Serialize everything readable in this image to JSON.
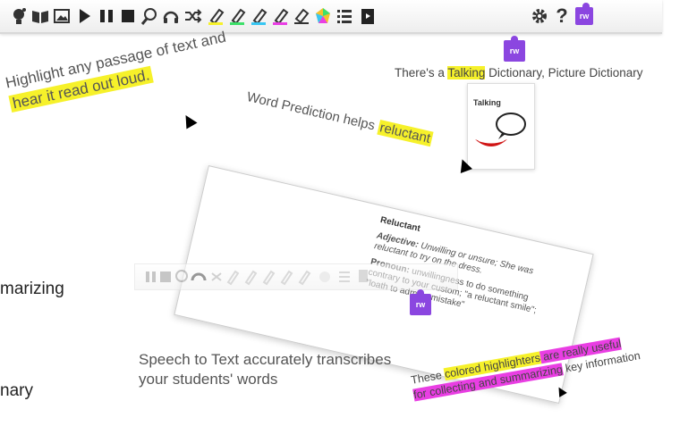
{
  "toolbar": {
    "rw_label": "rw",
    "icons": [
      "predict-icon",
      "book-icon",
      "picture-icon",
      "play-icon",
      "pause-icon",
      "stop-icon",
      "screenshot-reader-icon",
      "headphones-icon",
      "shuffle-icon",
      "highlighter-yellow-icon",
      "highlighter-green-icon",
      "highlighter-cyan-icon",
      "highlighter-magenta-icon",
      "eraser-icon",
      "colors-icon",
      "list-icon",
      "book-dark-icon",
      "gear-icon",
      "help-icon",
      "rw-logo-icon"
    ]
  },
  "captions": {
    "dictionary_prefix": "There's a",
    "dictionary_word": "Talking",
    "dictionary_suffix": " Dictionary, Picture Dictionary",
    "talking_label": "Talking",
    "highlight_line1": "Highlight any passage of text and",
    "highlight_line2": "hear it read out loud.",
    "prediction_prefix": "Word Prediction helps ",
    "prediction_word": "reluctant",
    "summarizing_fragment": "marizing",
    "nary_fragment": "nary",
    "speech_line1": "Speech to Text accurately transcribes",
    "speech_line2": "your students' words",
    "hl_prefix": "These ",
    "hl_yellow": "colored highlighters",
    "hl_magenta1": " are really useful",
    "hl_magenta2": "for collecting and summarizing",
    "hl_suffix": " key information"
  },
  "dictionary": {
    "headword": "Reluctant",
    "adj_label": "Adjective:",
    "adj_text": " Unwilling or unsure; She was reluctant to try on the dress.",
    "pron_label": "Pronoun:",
    "pron_text": " unwillingness to do something contrary to your custom; \"a reluctant smile\"; \"loath to admit a mistake\""
  },
  "colors": {
    "rw_purple": "#8b46e0",
    "highlight_yellow": "#f6f12a",
    "highlight_magenta": "#e93ee3"
  }
}
